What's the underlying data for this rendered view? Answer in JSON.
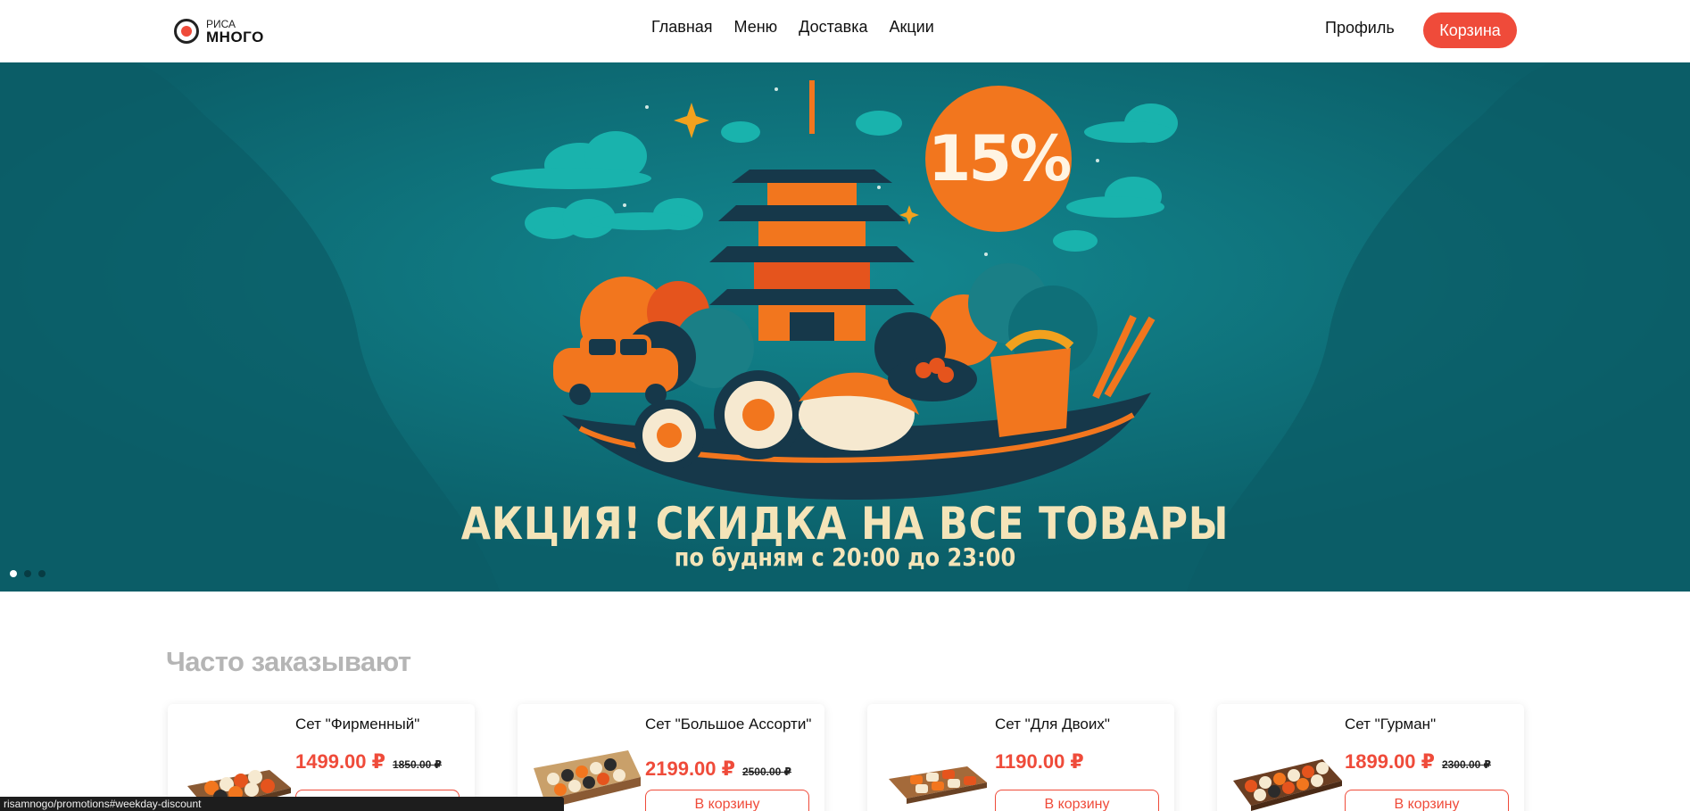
{
  "header": {
    "logo_top": "РИСА",
    "logo_bottom": "МНОГО",
    "nav": [
      {
        "label": "Главная"
      },
      {
        "label": "Меню"
      },
      {
        "label": "Доставка"
      },
      {
        "label": "Акции"
      }
    ],
    "profile_label": "Профиль",
    "cart_label": "Корзина"
  },
  "banner": {
    "discount": "15%",
    "title": "АКЦИЯ! СКИДКА НА ВСЕ ТОВАРЫ",
    "subtitle": "по будням с 20:00 до 23:00",
    "slides": 3,
    "active_slide": 1,
    "colors": {
      "background": "#0e6a74",
      "accent": "#f2761e",
      "text": "#f4e4b8"
    }
  },
  "popular": {
    "title": "Часто заказывают",
    "items": [
      {
        "name": "Сет \"Фирменный\"",
        "price": "1499.00 ₽",
        "old_price": "1850.00 ₽",
        "button": "В корзину"
      },
      {
        "name": "Сет \"Большое Ассорти\"",
        "price": "2199.00 ₽",
        "old_price": "2500.00 ₽",
        "button": "В корзину"
      },
      {
        "name": "Сет \"Для Двоих\"",
        "price": "1190.00 ₽",
        "old_price": "",
        "button": "В корзину"
      },
      {
        "name": "Сет \"Гурман\"",
        "price": "1899.00 ₽",
        "old_price": "2300.00 ₽",
        "button": "В корзину"
      }
    ]
  },
  "statusbar": {
    "url": "risamnogo/promotions#weekday-discount"
  },
  "colors": {
    "brand": "#ef4b3a",
    "section_title": "#b5b5b5"
  }
}
